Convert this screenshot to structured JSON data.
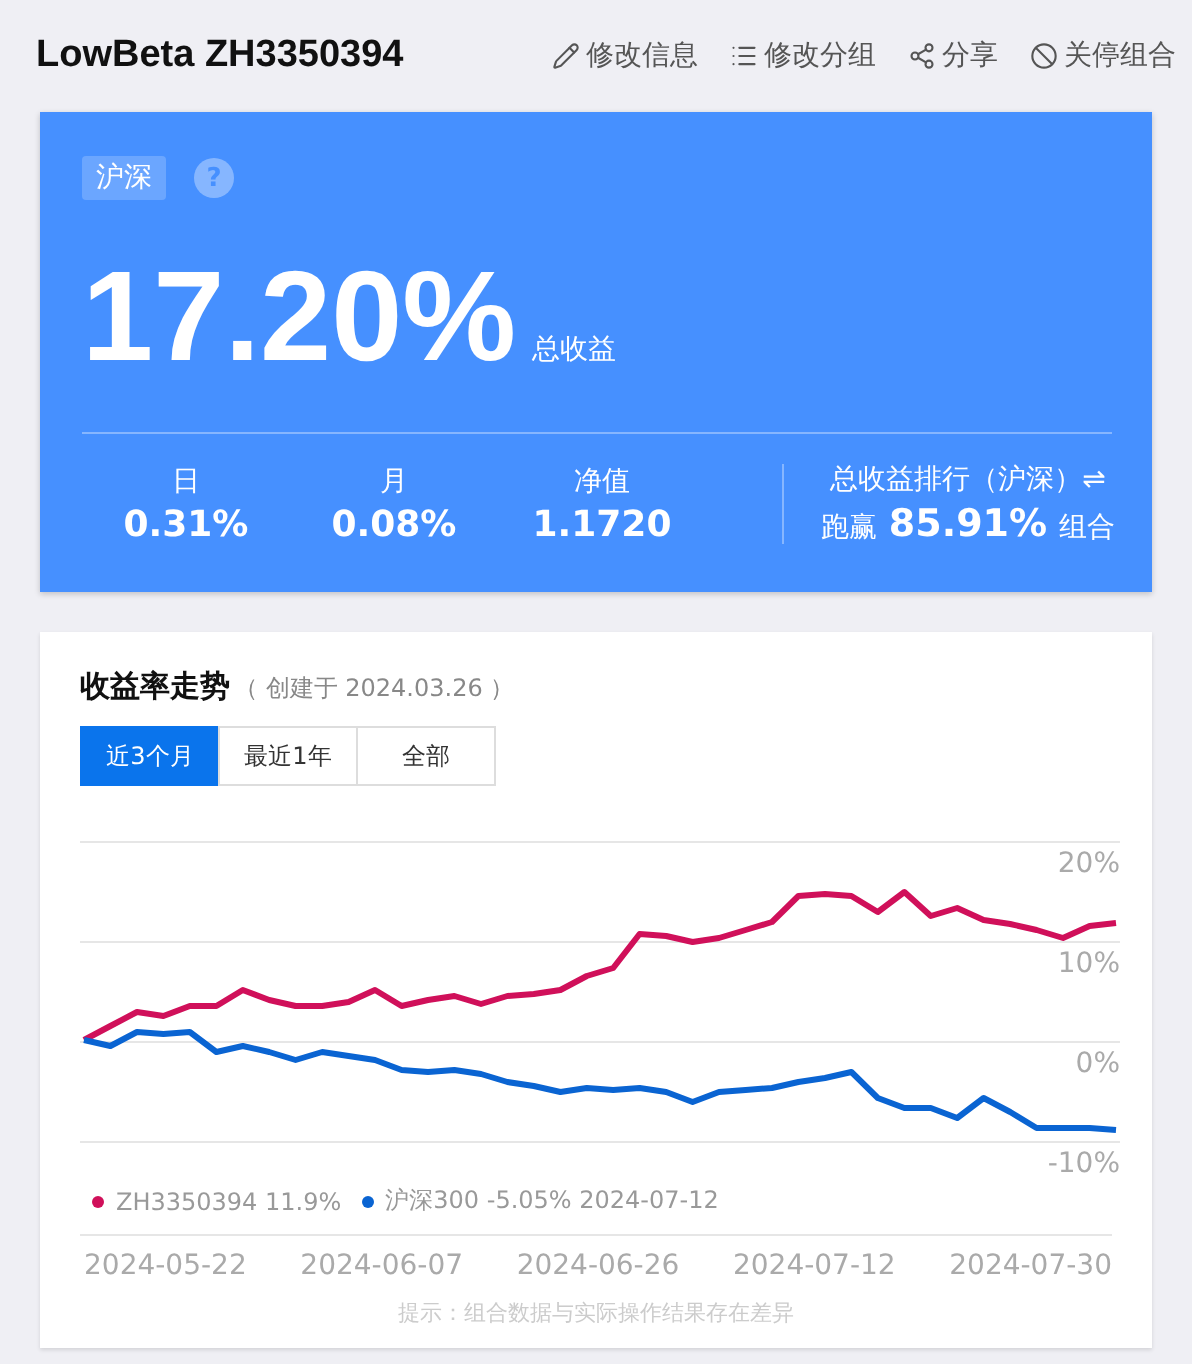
{
  "header": {
    "title": "LowBeta ZH3350394",
    "actions": [
      {
        "kind": "edit",
        "label": "修改信息"
      },
      {
        "kind": "group",
        "label": "修改分组"
      },
      {
        "kind": "share",
        "label": "分享"
      },
      {
        "kind": "stop",
        "label": "关停组合"
      }
    ]
  },
  "summary": {
    "market_tag": "沪深",
    "help": "?",
    "total_return": "17.20%",
    "total_return_label": "总收益",
    "stats": [
      {
        "label": "日",
        "value": "0.31%"
      },
      {
        "label": "月",
        "value": "0.08%"
      },
      {
        "label": "净值",
        "value": "1.1720"
      }
    ],
    "rank": {
      "title": "总收益排行（沪深）⇌",
      "prefix": "跑赢",
      "value": "85.91%",
      "suffix": "组合"
    }
  },
  "trend": {
    "title": "收益率走势",
    "created": "（ 创建于 2024.03.26 ）",
    "ranges": [
      {
        "label": "近3个月",
        "selected": true
      },
      {
        "label": "最近1年",
        "selected": false
      },
      {
        "label": "全部",
        "selected": false
      }
    ],
    "legend": [
      {
        "value": "11.9%"
      },
      {
        "value": "-5.05% 2024-07-12"
      }
    ],
    "x_labels": [
      "2024-05-22",
      "2024-06-07",
      "2024-06-26",
      "2024-07-12",
      "2024-07-30"
    ],
    "chart_data": {
      "type": "line",
      "ylim": [
        -10,
        20
      ],
      "yticks": [
        {
          "value": 20,
          "label": "20%"
        },
        {
          "value": 10,
          "label": "10%"
        },
        {
          "value": 0,
          "label": "0%"
        },
        {
          "value": -10,
          "label": "-10%"
        }
      ],
      "series": [
        {
          "name": "ZH3350394",
          "color": "#d0105a",
          "values": [
            0.2,
            1.6,
            3.0,
            2.6,
            3.6,
            3.6,
            5.2,
            4.2,
            3.6,
            3.6,
            4.0,
            5.2,
            3.6,
            4.2,
            4.6,
            3.8,
            4.6,
            4.8,
            5.2,
            6.6,
            7.4,
            10.8,
            10.6,
            10.0,
            10.4,
            11.2,
            12.0,
            14.6,
            14.8,
            14.6,
            13.0,
            15.0,
            12.6,
            13.4,
            12.2,
            11.8,
            11.2,
            10.4,
            11.6,
            11.9
          ]
        },
        {
          "name": "沪深300",
          "color": "#0a64d2",
          "values": [
            0.2,
            -0.4,
            1.0,
            0.8,
            1.0,
            -1.0,
            -0.4,
            -1.0,
            -1.8,
            -1.0,
            -1.4,
            -1.8,
            -2.8,
            -3.0,
            -2.8,
            -3.2,
            -4.0,
            -4.4,
            -5.0,
            -4.6,
            -4.8,
            -4.6,
            -5.0,
            -6.0,
            -5.0,
            -4.8,
            -4.6,
            -4.0,
            -3.6,
            -3.0,
            -5.6,
            -6.6,
            -6.6,
            -7.6,
            -5.6,
            -7.0,
            -8.6,
            -8.6,
            -8.6,
            -8.8
          ]
        }
      ]
    },
    "notice": "提示：组合数据与实际操作结果存在差异"
  }
}
